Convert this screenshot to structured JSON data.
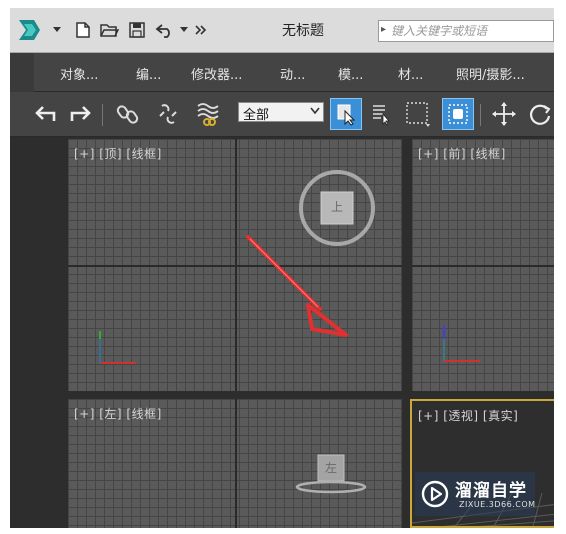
{
  "titlebar": {
    "title": "无标题",
    "search_placeholder": "键入关键字或短语"
  },
  "menu": {
    "items": [
      "对象...",
      "编...",
      "修改器...",
      "动...",
      "模...",
      "材...",
      "照明/摄影..."
    ]
  },
  "toolbar": {
    "selection_filter": "全部"
  },
  "viewports": {
    "top": "[+] [顶] [线框]",
    "front": "[+] [前] [线框]",
    "left": "[+] [左] [线框]",
    "perspective": "[+] [透视] [真实]"
  },
  "gizmos": {
    "top_cube_label": "上",
    "left_cube_label": "左"
  },
  "watermark": {
    "text": "溜溜自学",
    "sub": "ZIXUE.3D66.COM"
  },
  "colors": {
    "accent_blue": "#3a8fd6",
    "arrow_red": "#e03030",
    "active_viewport_border": "#c9a83c",
    "axis_x": "#d03030",
    "axis_y": "#30b030",
    "axis_z": "#4040e0"
  }
}
